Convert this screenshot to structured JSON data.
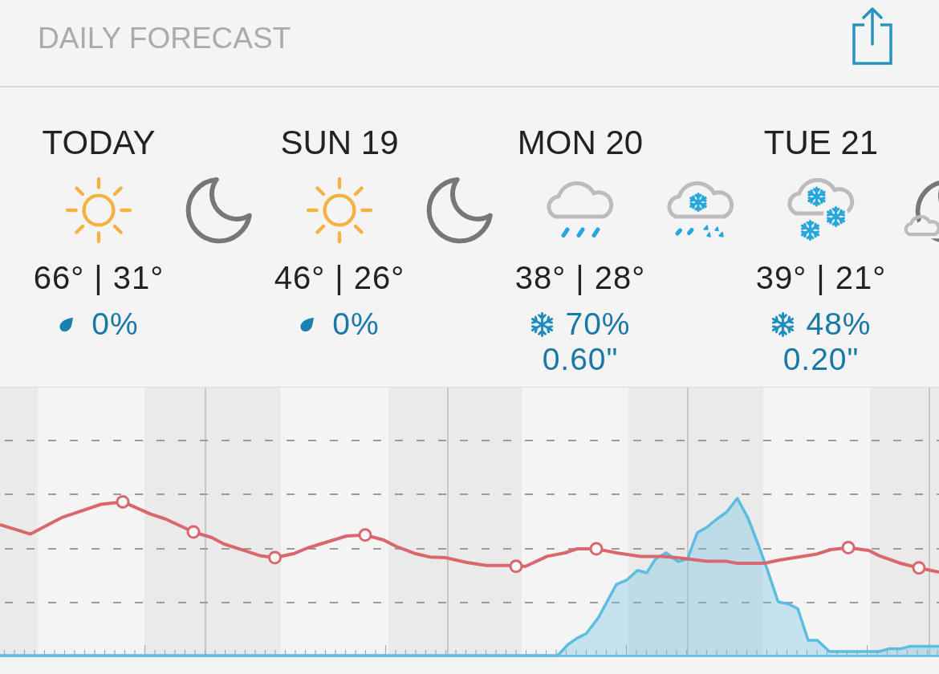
{
  "header": {
    "title": "DAILY FORECAST"
  },
  "days": [
    {
      "label": "TODAY",
      "day_icon": {
        "kind": "sunny"
      },
      "night_icon": {
        "kind": "clear"
      },
      "temps": "66° | 31°",
      "precip": {
        "kind": "rain",
        "chance": "0%"
      }
    },
    {
      "label": "SUN 19",
      "day_icon": {
        "kind": "sunny"
      },
      "night_icon": {
        "kind": "clear"
      },
      "temps": "46° | 26°",
      "precip": {
        "kind": "rain",
        "chance": "0%"
      }
    },
    {
      "label": "MON 20",
      "day_icon": {
        "kind": "rain"
      },
      "night_icon": {
        "kind": "mixed"
      },
      "temps": "38° | 28°",
      "precip": {
        "kind": "snow",
        "chance": "70%",
        "amount": "0.60\""
      }
    },
    {
      "label": "TUE 21",
      "day_icon": {
        "kind": "snow"
      },
      "night_icon": {
        "kind": "partly-cloudy"
      },
      "temps": "39° | 21°",
      "precip": {
        "kind": "snow",
        "chance": "48%",
        "amount": "0.20\""
      }
    }
  ]
}
